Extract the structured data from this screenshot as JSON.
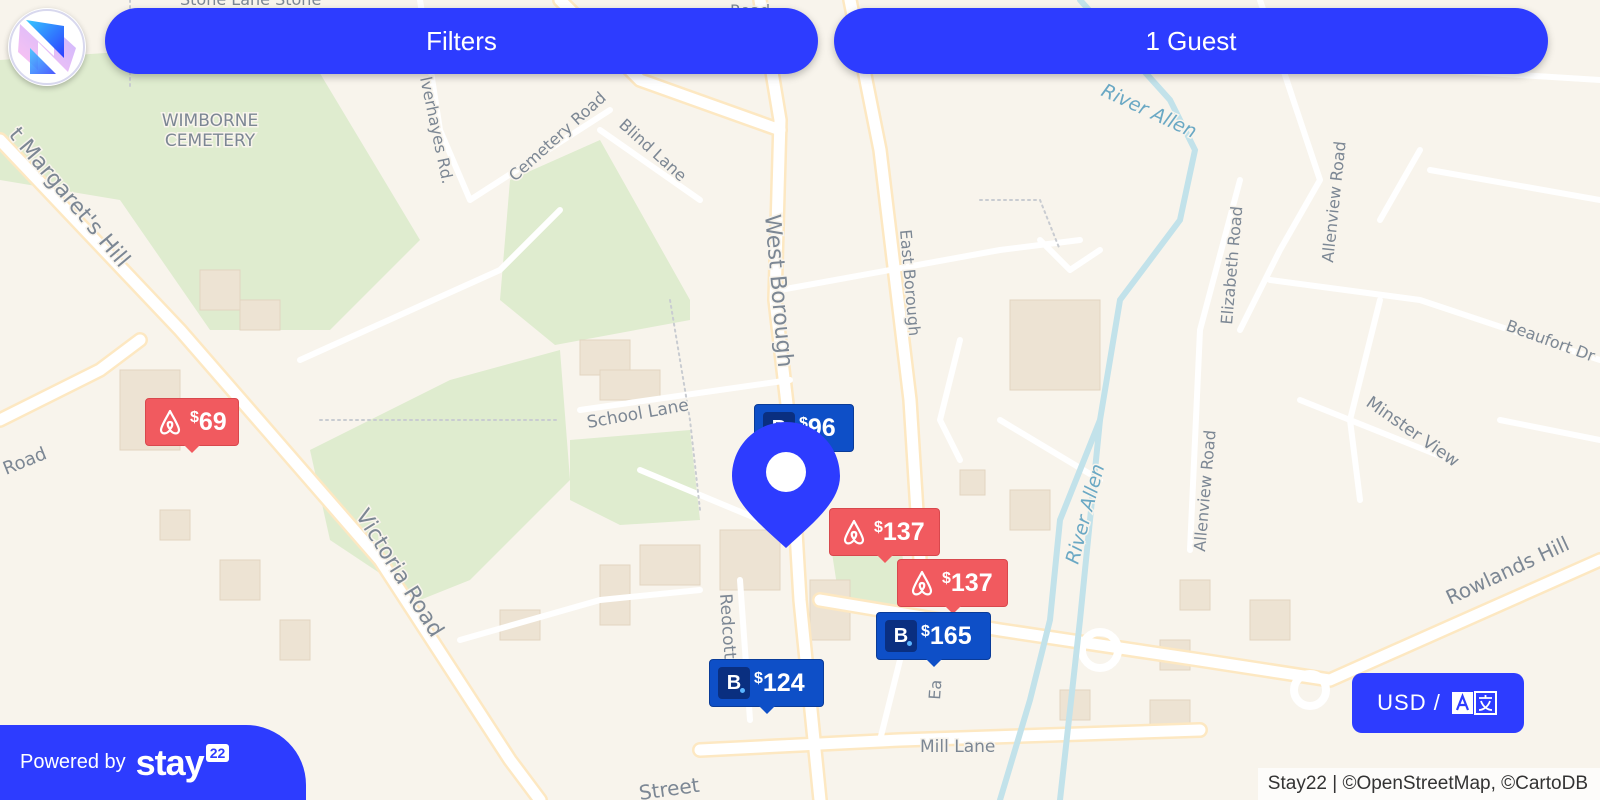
{
  "topbar": {
    "filters_label": "Filters",
    "guests_label": "1 Guest"
  },
  "map_labels": {
    "cemetery_line1": "WIMBORNE",
    "cemetery_line2": "CEMETERY",
    "streets": {
      "st_margarets_hill": "t Margaret's Hill",
      "victoria_road": "Victoria Road",
      "west_borough": "West Borough",
      "east_borough": "East Borough",
      "cemetery_road": "Cemetery Road",
      "blind_lane": "Blind Lane",
      "silverhayes": "lverhayes Rd.",
      "school_lane": "School Lane",
      "redcotts": "Redcotts",
      "elizabeth_road": "Elizabeth Road",
      "allenview_road_north": "Allenview Road",
      "allenview_road_south": "Allenview Road",
      "beaufort": "Beaufort Dr",
      "minster_view": "Minster View",
      "rowlands_hill": "Rowlands Hill",
      "mill_lane": "Mill Lane",
      "road_left": "Road",
      "street_bottom": "Street",
      "top_street": "Stone Lane Stone",
      "top_road": "Road",
      "east_cut": "Ea"
    },
    "river_north": "River Allen",
    "river_south": "River Allen"
  },
  "markers": [
    {
      "provider": "airbnb",
      "currency": "$",
      "amount": "69"
    },
    {
      "provider": "booking",
      "currency": "$",
      "amount": "96"
    },
    {
      "provider": "airbnb",
      "currency": "$",
      "amount": "137"
    },
    {
      "provider": "airbnb",
      "currency": "$",
      "amount": "137"
    },
    {
      "provider": "booking",
      "currency": "$",
      "amount": "165"
    },
    {
      "provider": "booking",
      "currency": "$",
      "amount": "124"
    }
  ],
  "booking_glyph": "B",
  "footer": {
    "powered_by": "Powered by",
    "brand_word": "stay",
    "brand_badge": "22",
    "attribution": "Stay22 | ©OpenStreetMap, ©CartoDB"
  },
  "currency": {
    "label": "USD /",
    "language_icon": "language-translate-icon"
  },
  "colors": {
    "accent": "#2d3cff",
    "airbnb": "#f15a5f",
    "booking": "#0e4fc7",
    "park": "#dfeccf",
    "water": "#c2e2ea",
    "land": "#f8f4ec"
  }
}
